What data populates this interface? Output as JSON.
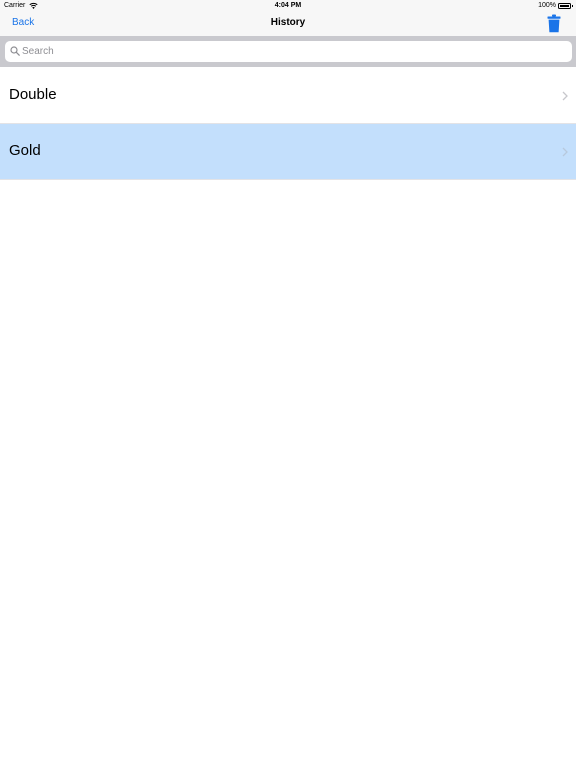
{
  "status_bar": {
    "carrier": "Carrier",
    "time": "4:04 PM",
    "battery": "100%"
  },
  "nav": {
    "back_label": "Back",
    "title": "History",
    "trash_icon": "trash-icon",
    "accent_color": "#1a74e8"
  },
  "search": {
    "placeholder": "Search",
    "value": ""
  },
  "list": {
    "items": [
      {
        "label": "Double",
        "selected": false
      },
      {
        "label": "Gold",
        "selected": true
      }
    ],
    "selected_color": "#c3dffc"
  }
}
